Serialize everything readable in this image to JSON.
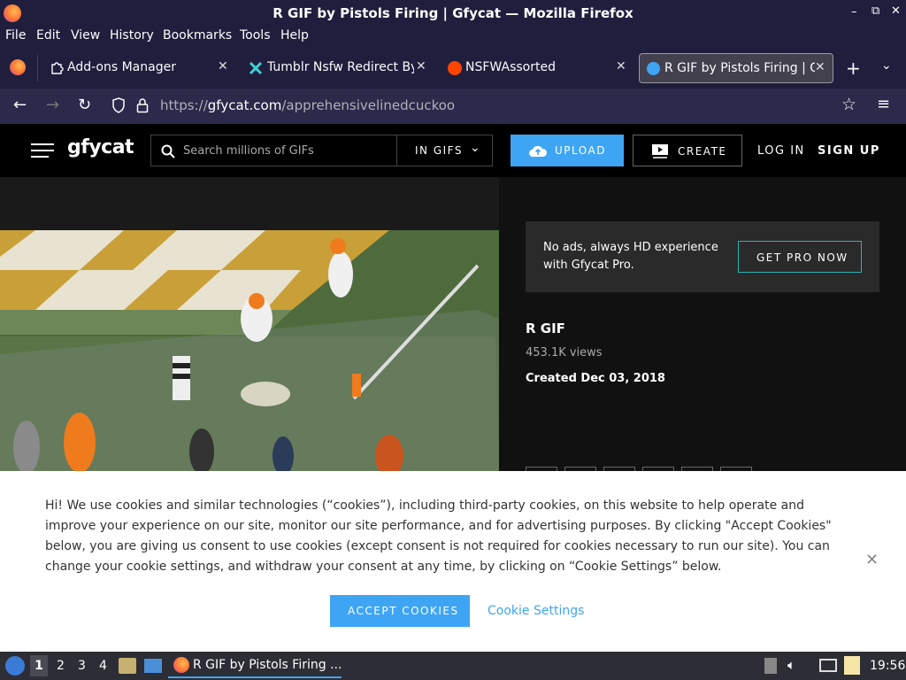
{
  "window": {
    "title": "R GIF by Pistols Firing | Gfycat — Mozilla Firefox"
  },
  "menu": [
    "File",
    "Edit",
    "View",
    "History",
    "Bookmarks",
    "Tools",
    "Help"
  ],
  "tabs": [
    {
      "label": "Add-ons Manager"
    },
    {
      "label": "Tumblr Nsfw Redirect Byp"
    },
    {
      "label": "NSFWAssorted"
    },
    {
      "label": "R GIF by Pistols Firing | G"
    }
  ],
  "url": {
    "prefix": "https://",
    "host": "gfycat.com",
    "path": "/apprehensivelinedcuckoo"
  },
  "gfycat": {
    "logo": "gfycat",
    "search_placeholder": "Search millions of GIFs",
    "search_scope": "IN GIFS",
    "upload": "UPLOAD",
    "create": "CREATE",
    "login": "LOG IN",
    "signup": "SIGN UP",
    "promo_text": "No ads, always HD experience with Gfycat Pro.",
    "promo_button": "GET PRO NOW",
    "gif_title": "R GIF",
    "views": "453.1K views",
    "created": "Created Dec 03, 2018"
  },
  "cookie": {
    "text": "Hi! We use cookies and similar technologies (“cookies”), including third-party cookies, on this website to help operate and improve your experience on our site, monitor our site performance, and for advertising purposes. By clicking \"Accept Cookies\" below, you are giving us consent to use cookies (except consent is not required for cookies necessary to run our site). You can change your cookie settings, and withdraw your consent at any time, by clicking on “Cookie Settings” below.",
    "accept": "ACCEPT COOKIES",
    "settings": "Cookie Settings"
  },
  "taskbar": {
    "workspaces": [
      "1",
      "2",
      "3",
      "4"
    ],
    "window_label": "R GIF by Pistols Firing ...",
    "clock": "19:56"
  },
  "colors": {
    "accent": "#3ea5f5",
    "firefox_chrome": "#1f1e3c",
    "teal_border": "#2ab6b6"
  }
}
